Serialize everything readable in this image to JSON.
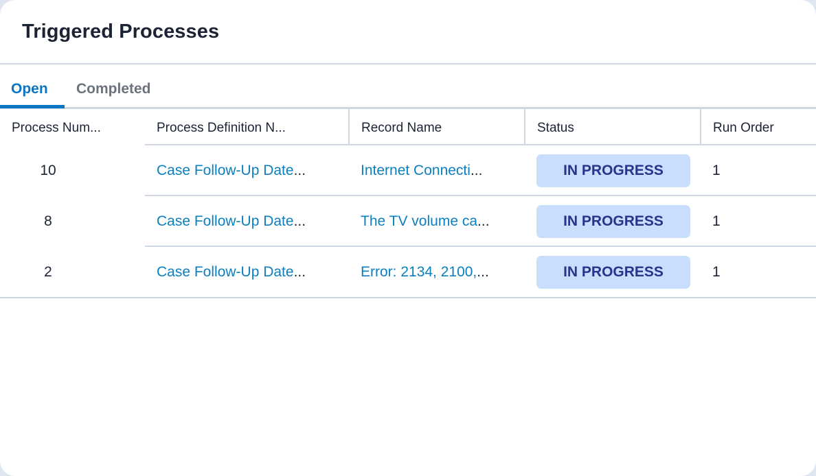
{
  "card": {
    "title": "Triggered Processes"
  },
  "tabs": [
    {
      "label": "Open",
      "active": true
    },
    {
      "label": "Completed",
      "active": false
    }
  ],
  "table": {
    "columns": [
      "Process Num...",
      "Process Definition N...",
      "Record Name",
      "Status",
      "Run Order"
    ],
    "rows": [
      {
        "process_number": "10",
        "process_definition": "Case Follow-Up Date",
        "record_name": "Internet Connecti",
        "status": "IN PROGRESS",
        "run_order": "1"
      },
      {
        "process_number": "8",
        "process_definition": "Case Follow-Up Date",
        "record_name": "The TV volume ca",
        "status": "IN PROGRESS",
        "run_order": "1"
      },
      {
        "process_number": "2",
        "process_definition": "Case Follow-Up Date",
        "record_name": "Error: 2134, 2100,",
        "status": "IN PROGRESS",
        "run_order": "1"
      }
    ],
    "ellipsis": "..."
  },
  "colors": {
    "accent": "#0b74c4",
    "link": "#0b7fc0",
    "badge_bg": "#c9ddfc",
    "badge_text": "#27348b",
    "divider": "#cfd8e2",
    "text": "#1b2334"
  }
}
